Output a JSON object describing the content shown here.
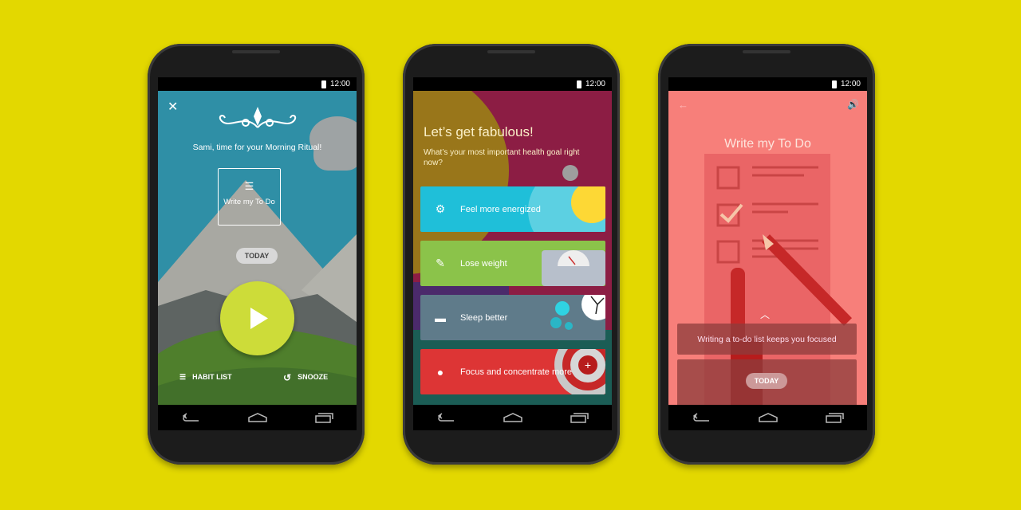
{
  "status_time": "12:00",
  "phone1": {
    "greeting": "Sami, time for your Morning Ritual!",
    "habit_card": "Write my To Do",
    "today": "TODAY",
    "habit_list": "HABIT LIST",
    "snooze": "SNOOZE"
  },
  "phone2": {
    "title": "Let’s get fabulous!",
    "subtitle": "What’s your most important health goal right now?",
    "goals": [
      {
        "label": "Feel more energized",
        "icon": "sun-gear-icon",
        "color": "#1fbfd9"
      },
      {
        "label": "Lose weight",
        "icon": "dumbbell-icon",
        "color": "#8bc34a"
      },
      {
        "label": "Sleep better",
        "icon": "bed-icon",
        "color": "#5f7b8a"
      },
      {
        "label": "Focus and concentrate more",
        "icon": "lightbulb-icon",
        "color": "#dd3535"
      }
    ]
  },
  "phone3": {
    "title": "Write my To Do",
    "tip": "Writing a to-do list keeps you focused",
    "today": "TODAY"
  }
}
